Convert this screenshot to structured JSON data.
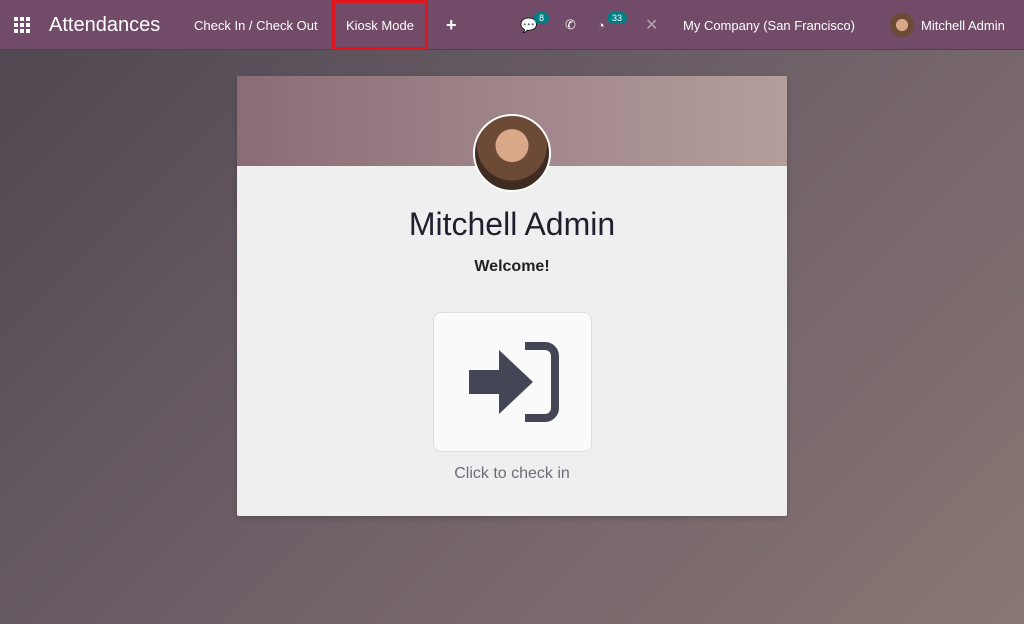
{
  "nav": {
    "app_title": "Attendances",
    "menu": [
      "Check In / Check Out",
      "Kiosk Mode"
    ],
    "messages_count": "8",
    "activities_count": "33",
    "company": "My Company (San Francisco)",
    "user": "Mitchell Admin"
  },
  "card": {
    "name": "Mitchell Admin",
    "welcome": "Welcome!",
    "hint": "Click to check in"
  },
  "colors": {
    "navbar": "#714b67",
    "badge": "#017e84",
    "highlight": "#e0141e"
  }
}
